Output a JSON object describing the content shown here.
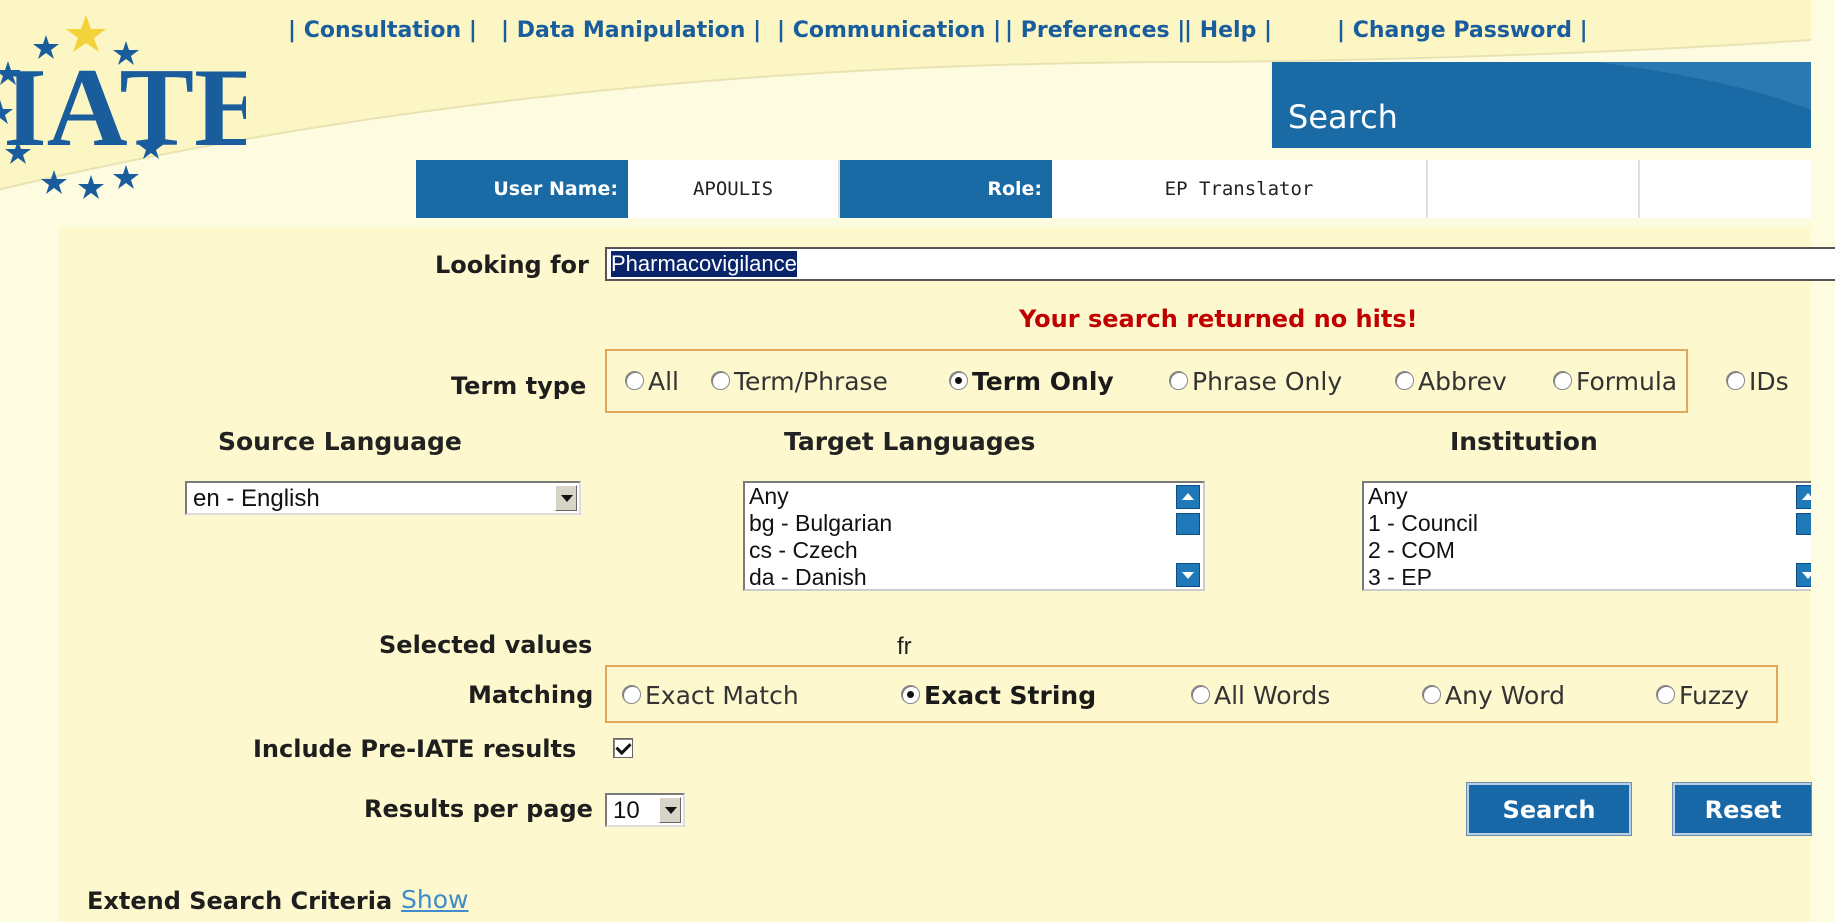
{
  "nav": {
    "items": [
      {
        "label": "Consultation"
      },
      {
        "label": "Data Manipulation"
      },
      {
        "label": "Communication"
      },
      {
        "label": "Preferences"
      },
      {
        "label": "Help"
      },
      {
        "label": "Change Password"
      }
    ],
    "separator": "|"
  },
  "logo": {
    "text": "IATE"
  },
  "header": {
    "tab_label": "Search"
  },
  "user": {
    "username_label": "User Name:",
    "username": "APOULIS",
    "role_label": "Role:",
    "role": "EP Translator"
  },
  "search": {
    "looking_for_label": "Looking for",
    "query": "Pharmacovigilance",
    "no_hits_message": "Your search returned no hits!"
  },
  "term_type": {
    "label": "Term type",
    "options": [
      {
        "label": "All",
        "checked": false
      },
      {
        "label": "Term/Phrase",
        "checked": false
      },
      {
        "label": "Term Only",
        "checked": true
      },
      {
        "label": "Phrase Only",
        "checked": false
      },
      {
        "label": "Abbrev",
        "checked": false
      },
      {
        "label": "Formula",
        "checked": false
      },
      {
        "label": "IDs",
        "checked": false
      }
    ]
  },
  "source_language": {
    "label": "Source Language",
    "selected": "en - English"
  },
  "target_languages": {
    "label": "Target Languages",
    "options": [
      "Any",
      "bg - Bulgarian",
      "cs - Czech",
      "da - Danish"
    ]
  },
  "institution": {
    "label": "Institution",
    "options": [
      "Any",
      "1 - Council",
      "2 - COM",
      "3 - EP"
    ]
  },
  "selected_values": {
    "label": "Selected values",
    "value": "fr"
  },
  "matching": {
    "label": "Matching",
    "options": [
      {
        "label": "Exact Match",
        "checked": false
      },
      {
        "label": "Exact String",
        "checked": true
      },
      {
        "label": "All Words",
        "checked": false
      },
      {
        "label": "Any Word",
        "checked": false
      },
      {
        "label": "Fuzzy",
        "checked": false
      }
    ]
  },
  "pre_iate": {
    "label": "Include Pre-IATE results",
    "checked": true
  },
  "results_per_page": {
    "label": "Results per page",
    "value": "10"
  },
  "buttons": {
    "search": "Search",
    "reset": "Reset"
  },
  "extend": {
    "label": "Extend Search Criteria",
    "link": "Show"
  },
  "colors": {
    "header_blue": "#196aa5",
    "panel_bg": "#fdf8cd",
    "no_hits_red": "#c00000",
    "nav_blue": "#1a5d9c",
    "option_border": "#e0a85a"
  }
}
